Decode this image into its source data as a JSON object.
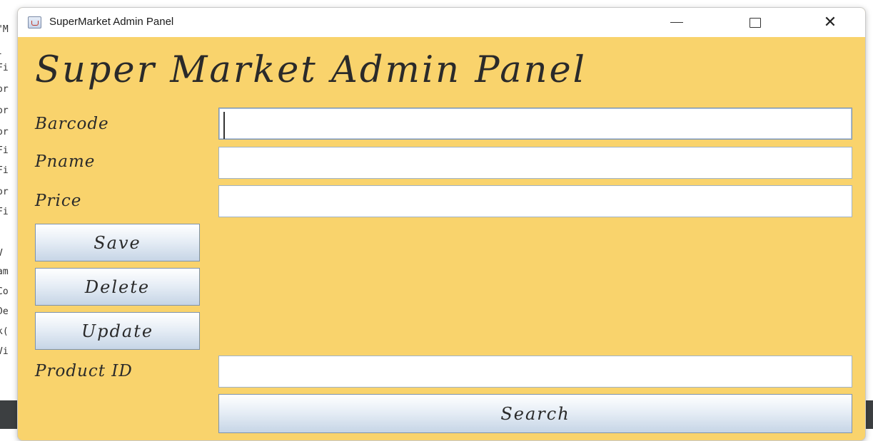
{
  "window": {
    "title": "SuperMarket Admin Panel",
    "controls": {
      "minimize": "minimize-icon",
      "maximize": "maximize-icon",
      "close": "close-icon"
    }
  },
  "panel": {
    "heading": "Super Market Admin Panel",
    "fields": {
      "barcode": {
        "label": "Barcode",
        "value": "",
        "placeholder": ""
      },
      "pname": {
        "label": "Pname",
        "value": "",
        "placeholder": ""
      },
      "price": {
        "label": "Price",
        "value": "",
        "placeholder": ""
      },
      "product_id": {
        "label": "Product ID",
        "value": "",
        "placeholder": ""
      }
    },
    "buttons": {
      "save": "Save",
      "delete": "Delete",
      "update": "Update",
      "search": "Search"
    }
  },
  "colors": {
    "panel_background": "#f9d36c",
    "button_border": "#7d93ad",
    "field_border": "#9fb3c8"
  }
}
